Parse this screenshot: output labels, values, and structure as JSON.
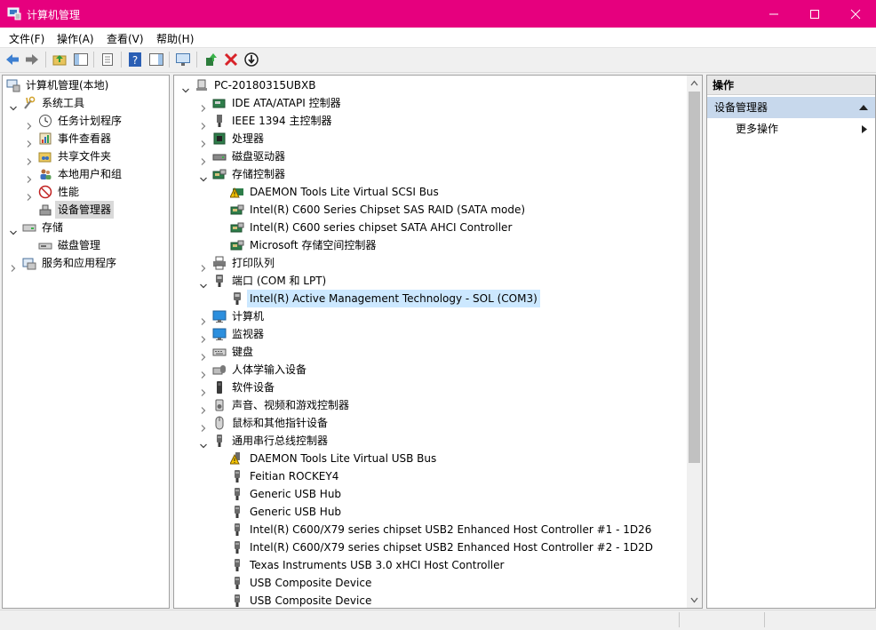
{
  "window": {
    "title": "计算机管理"
  },
  "menu": [
    "文件(F)",
    "操作(A)",
    "查看(V)",
    "帮助(H)"
  ],
  "left_tree": [
    {
      "label": "计算机管理(本地)",
      "depth": 0,
      "exp": "none",
      "icon": "computer-management-icon"
    },
    {
      "label": "系统工具",
      "depth": 1,
      "exp": "open",
      "icon": "tools-icon"
    },
    {
      "label": "任务计划程序",
      "depth": 2,
      "exp": "closed",
      "icon": "clock-icon"
    },
    {
      "label": "事件查看器",
      "depth": 2,
      "exp": "closed",
      "icon": "event-viewer-icon"
    },
    {
      "label": "共享文件夹",
      "depth": 2,
      "exp": "closed",
      "icon": "shared-folder-icon"
    },
    {
      "label": "本地用户和组",
      "depth": 2,
      "exp": "closed",
      "icon": "users-icon"
    },
    {
      "label": "性能",
      "depth": 2,
      "exp": "closed",
      "icon": "performance-icon"
    },
    {
      "label": "设备管理器",
      "depth": 2,
      "exp": "none",
      "icon": "device-manager-icon",
      "state": "gray"
    },
    {
      "label": "存储",
      "depth": 1,
      "exp": "open",
      "icon": "storage-icon"
    },
    {
      "label": "磁盘管理",
      "depth": 2,
      "exp": "none",
      "icon": "disk-management-icon"
    },
    {
      "label": "服务和应用程序",
      "depth": 1,
      "exp": "closed",
      "icon": "services-icon"
    }
  ],
  "device_tree": [
    {
      "label": "PC-20180315UBXB",
      "depth": 0,
      "exp": "open",
      "icon": "computer-icon"
    },
    {
      "label": "IDE ATA/ATAPI 控制器",
      "depth": 1,
      "exp": "closed",
      "icon": "ide-controller-icon"
    },
    {
      "label": "IEEE 1394 主控制器",
      "depth": 1,
      "exp": "closed",
      "icon": "ieee1394-icon"
    },
    {
      "label": "处理器",
      "depth": 1,
      "exp": "closed",
      "icon": "processor-icon"
    },
    {
      "label": "磁盘驱动器",
      "depth": 1,
      "exp": "closed",
      "icon": "disk-drive-icon"
    },
    {
      "label": "存储控制器",
      "depth": 1,
      "exp": "open",
      "icon": "storage-controller-icon"
    },
    {
      "label": "DAEMON Tools Lite Virtual SCSI Bus",
      "depth": 2,
      "exp": "none",
      "icon": "warning-device-icon"
    },
    {
      "label": "Intel(R) C600 Series Chipset SAS RAID (SATA mode)",
      "depth": 2,
      "exp": "none",
      "icon": "storage-controller-icon"
    },
    {
      "label": "Intel(R) C600 series chipset SATA AHCI Controller",
      "depth": 2,
      "exp": "none",
      "icon": "storage-controller-icon"
    },
    {
      "label": "Microsoft 存储空间控制器",
      "depth": 2,
      "exp": "none",
      "icon": "storage-controller-icon"
    },
    {
      "label": "打印队列",
      "depth": 1,
      "exp": "closed",
      "icon": "printer-icon"
    },
    {
      "label": "端口 (COM 和 LPT)",
      "depth": 1,
      "exp": "open",
      "icon": "port-icon"
    },
    {
      "label": "Intel(R) Active Management Technology - SOL (COM3)",
      "depth": 2,
      "exp": "none",
      "icon": "port-icon",
      "state": "selected"
    },
    {
      "label": "计算机",
      "depth": 1,
      "exp": "closed",
      "icon": "monitor-icon"
    },
    {
      "label": "监视器",
      "depth": 1,
      "exp": "closed",
      "icon": "monitor-icon"
    },
    {
      "label": "键盘",
      "depth": 1,
      "exp": "closed",
      "icon": "keyboard-icon"
    },
    {
      "label": "人体学输入设备",
      "depth": 1,
      "exp": "closed",
      "icon": "hid-icon"
    },
    {
      "label": "软件设备",
      "depth": 1,
      "exp": "closed",
      "icon": "software-device-icon"
    },
    {
      "label": "声音、视频和游戏控制器",
      "depth": 1,
      "exp": "closed",
      "icon": "speaker-icon"
    },
    {
      "label": "鼠标和其他指针设备",
      "depth": 1,
      "exp": "closed",
      "icon": "mouse-icon"
    },
    {
      "label": "通用串行总线控制器",
      "depth": 1,
      "exp": "open",
      "icon": "usb-icon"
    },
    {
      "label": "DAEMON Tools Lite Virtual USB Bus",
      "depth": 2,
      "exp": "none",
      "icon": "warning-usb-icon"
    },
    {
      "label": "Feitian ROCKEY4",
      "depth": 2,
      "exp": "none",
      "icon": "usb-icon"
    },
    {
      "label": "Generic USB Hub",
      "depth": 2,
      "exp": "none",
      "icon": "usb-icon"
    },
    {
      "label": "Generic USB Hub",
      "depth": 2,
      "exp": "none",
      "icon": "usb-icon"
    },
    {
      "label": "Intel(R) C600/X79 series chipset USB2 Enhanced Host Controller #1 - 1D26",
      "depth": 2,
      "exp": "none",
      "icon": "usb-icon"
    },
    {
      "label": "Intel(R) C600/X79 series chipset USB2 Enhanced Host Controller #2 - 1D2D",
      "depth": 2,
      "exp": "none",
      "icon": "usb-icon"
    },
    {
      "label": "Texas Instruments USB 3.0 xHCI Host Controller",
      "depth": 2,
      "exp": "none",
      "icon": "usb-icon"
    },
    {
      "label": "USB Composite Device",
      "depth": 2,
      "exp": "none",
      "icon": "usb-icon"
    },
    {
      "label": "USB Composite Device",
      "depth": 2,
      "exp": "none",
      "icon": "usb-icon"
    }
  ],
  "actions": {
    "header": "操作",
    "group": "设备管理器",
    "more": "更多操作"
  },
  "colors": {
    "titlebar": "#e6007e",
    "selection": "#cce8ff",
    "actions_group": "#c7d8ec"
  }
}
